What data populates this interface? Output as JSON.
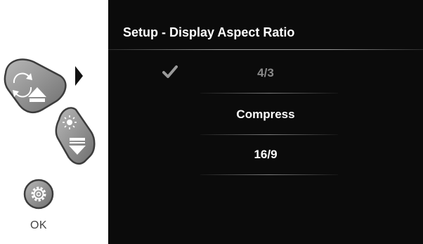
{
  "controls": {
    "selector_arrow_icon": "play-right-arrow-icon",
    "up_key_icon": "rotate-up-key-icon",
    "down_key_icon": "brightness-down-key-icon",
    "ok_key_icon": "gear-icon",
    "ok_label": "OK"
  },
  "screen": {
    "title": "Setup - Display Aspect Ratio",
    "options": [
      {
        "label": "4/3",
        "selected": true
      },
      {
        "label": "Compress",
        "selected": false
      },
      {
        "label": "16/9",
        "selected": false
      }
    ]
  },
  "colors": {
    "screen_bg": "#0b0b0b",
    "text": "#ffffff",
    "selected_text": "#8a8a8a",
    "key_fill": "#8e8e8e"
  }
}
